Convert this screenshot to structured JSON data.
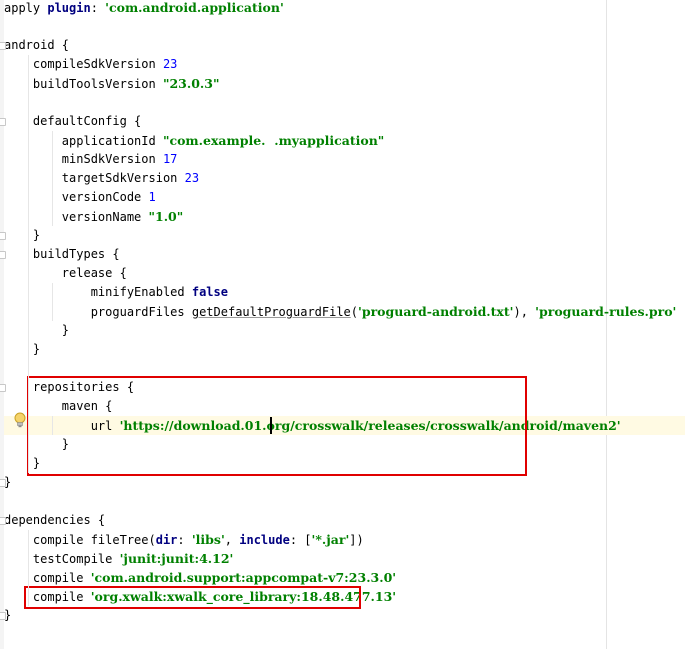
{
  "editor": {
    "lines": [
      {
        "tokens": [
          {
            "t": "plain",
            "v": "apply "
          },
          {
            "t": "kw",
            "v": "plugin"
          },
          {
            "t": "plain",
            "v": ": "
          },
          {
            "t": "str",
            "v": "'com.android.application'"
          }
        ]
      },
      {
        "tokens": []
      },
      {
        "tokens": [
          {
            "t": "plain",
            "v": "android {"
          }
        ]
      },
      {
        "tokens": [
          {
            "t": "plain",
            "v": "    compileSdkVersion "
          },
          {
            "t": "num",
            "v": "23"
          }
        ]
      },
      {
        "tokens": [
          {
            "t": "plain",
            "v": "    buildToolsVersion "
          },
          {
            "t": "str",
            "v": "\"23.0.3\""
          }
        ]
      },
      {
        "tokens": []
      },
      {
        "tokens": [
          {
            "t": "plain",
            "v": "    defaultConfig {"
          }
        ]
      },
      {
        "tokens": [
          {
            "t": "plain",
            "v": "        applicationId "
          },
          {
            "t": "str",
            "v": "\"com.example.  .myapplication\""
          }
        ]
      },
      {
        "tokens": [
          {
            "t": "plain",
            "v": "        minSdkVersion "
          },
          {
            "t": "num",
            "v": "17"
          }
        ]
      },
      {
        "tokens": [
          {
            "t": "plain",
            "v": "        targetSdkVersion "
          },
          {
            "t": "num",
            "v": "23"
          }
        ]
      },
      {
        "tokens": [
          {
            "t": "plain",
            "v": "        versionCode "
          },
          {
            "t": "num",
            "v": "1"
          }
        ]
      },
      {
        "tokens": [
          {
            "t": "plain",
            "v": "        versionName "
          },
          {
            "t": "str",
            "v": "\"1.0\""
          }
        ]
      },
      {
        "tokens": [
          {
            "t": "plain",
            "v": "    }"
          }
        ]
      },
      {
        "tokens": [
          {
            "t": "plain",
            "v": "    buildTypes {"
          }
        ]
      },
      {
        "tokens": [
          {
            "t": "plain",
            "v": "        release {"
          }
        ]
      },
      {
        "tokens": [
          {
            "t": "plain",
            "v": "            minifyEnabled "
          },
          {
            "t": "kw",
            "v": "false"
          }
        ]
      },
      {
        "tokens": [
          {
            "t": "plain",
            "v": "            proguardFiles "
          },
          {
            "t": "u",
            "v": "getDefaultProguardFile"
          },
          {
            "t": "plain",
            "v": "("
          },
          {
            "t": "str",
            "v": "'proguard-android.txt'"
          },
          {
            "t": "plain",
            "v": "), "
          },
          {
            "t": "str",
            "v": "'proguard-rules.pro'"
          }
        ]
      },
      {
        "tokens": [
          {
            "t": "plain",
            "v": "        }"
          }
        ]
      },
      {
        "tokens": [
          {
            "t": "plain",
            "v": "    }"
          }
        ]
      },
      {
        "tokens": []
      },
      {
        "tokens": [
          {
            "t": "plain",
            "v": "    repositories {"
          }
        ]
      },
      {
        "tokens": [
          {
            "t": "plain",
            "v": "        maven {"
          }
        ]
      },
      {
        "tokens": [
          {
            "t": "plain",
            "v": "            url "
          },
          {
            "t": "str",
            "v": "'https://download.01.org/crosswalk/releases/crosswalk/android/maven2'"
          }
        ],
        "current": true
      },
      {
        "tokens": [
          {
            "t": "plain",
            "v": "        }"
          }
        ]
      },
      {
        "tokens": [
          {
            "t": "plain",
            "v": "    }"
          }
        ]
      },
      {
        "tokens": [
          {
            "t": "plain",
            "v": "}"
          }
        ]
      },
      {
        "tokens": []
      },
      {
        "tokens": [
          {
            "t": "plain",
            "v": "dependencies {"
          }
        ]
      },
      {
        "tokens": [
          {
            "t": "plain",
            "v": "    compile fileTree("
          },
          {
            "t": "kw",
            "v": "dir"
          },
          {
            "t": "plain",
            "v": ": "
          },
          {
            "t": "str",
            "v": "'libs'"
          },
          {
            "t": "plain",
            "v": ", "
          },
          {
            "t": "kw",
            "v": "include"
          },
          {
            "t": "plain",
            "v": ": ["
          },
          {
            "t": "str",
            "v": "'*.jar'"
          },
          {
            "t": "plain",
            "v": "])"
          }
        ]
      },
      {
        "tokens": [
          {
            "t": "plain",
            "v": "    testCompile "
          },
          {
            "t": "str",
            "v": "'junit:junit:4.12'"
          }
        ]
      },
      {
        "tokens": [
          {
            "t": "plain",
            "v": "    compile "
          },
          {
            "t": "str",
            "v": "'com.android.support:appcompat-v7:23.3.0'"
          }
        ]
      },
      {
        "tokens": [
          {
            "t": "plain",
            "v": "    compile "
          },
          {
            "t": "str",
            "v": "'org.xwalk:xwalk_core_library:18.48.477.13'"
          }
        ]
      },
      {
        "tokens": [
          {
            "t": "plain",
            "v": "}"
          }
        ]
      }
    ]
  },
  "colors": {
    "keyword": "#000080",
    "string": "#008000",
    "number": "#0000ff",
    "highlight_box": "#e00000",
    "current_line": "#fffae3"
  },
  "icons": {
    "gutter_intention": "lightbulb-icon",
    "fold_marker": "fold-marker-icon"
  }
}
